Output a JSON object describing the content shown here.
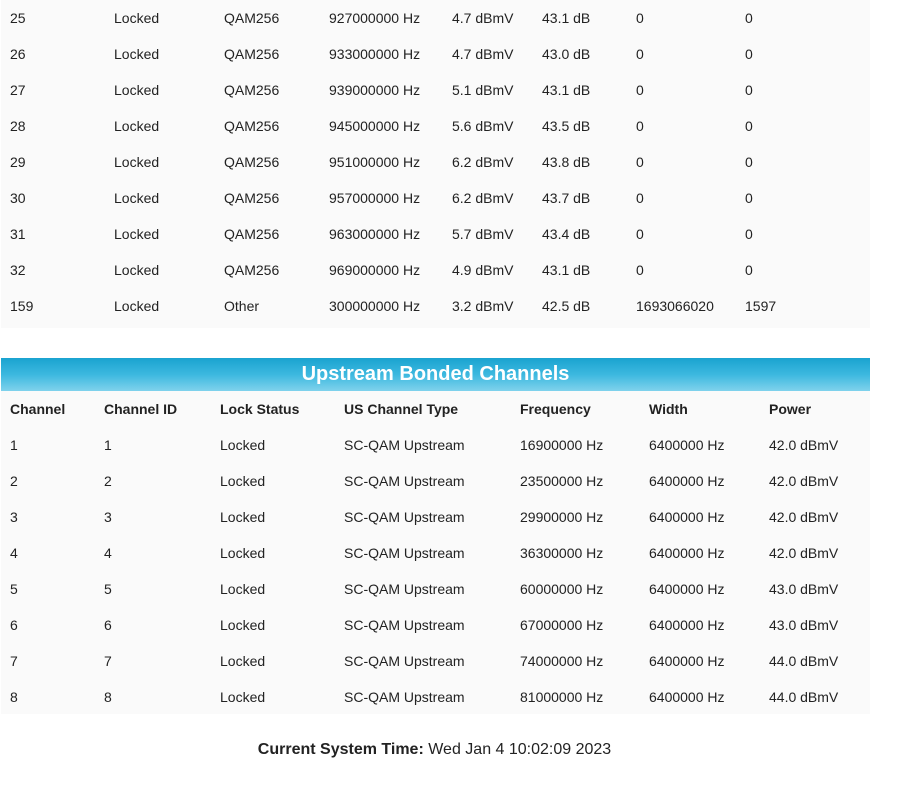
{
  "downstream": {
    "rows": [
      {
        "channel": "25",
        "lock_status": "Locked",
        "modulation": "QAM256",
        "frequency": "927000000 Hz",
        "power": "4.7 dBmV",
        "snr": "43.1 dB",
        "corrected": "0",
        "uncorrectables": "0"
      },
      {
        "channel": "26",
        "lock_status": "Locked",
        "modulation": "QAM256",
        "frequency": "933000000 Hz",
        "power": "4.7 dBmV",
        "snr": "43.0 dB",
        "corrected": "0",
        "uncorrectables": "0"
      },
      {
        "channel": "27",
        "lock_status": "Locked",
        "modulation": "QAM256",
        "frequency": "939000000 Hz",
        "power": "5.1 dBmV",
        "snr": "43.1 dB",
        "corrected": "0",
        "uncorrectables": "0"
      },
      {
        "channel": "28",
        "lock_status": "Locked",
        "modulation": "QAM256",
        "frequency": "945000000 Hz",
        "power": "5.6 dBmV",
        "snr": "43.5 dB",
        "corrected": "0",
        "uncorrectables": "0"
      },
      {
        "channel": "29",
        "lock_status": "Locked",
        "modulation": "QAM256",
        "frequency": "951000000 Hz",
        "power": "6.2 dBmV",
        "snr": "43.8 dB",
        "corrected": "0",
        "uncorrectables": "0"
      },
      {
        "channel": "30",
        "lock_status": "Locked",
        "modulation": "QAM256",
        "frequency": "957000000 Hz",
        "power": "6.2 dBmV",
        "snr": "43.7 dB",
        "corrected": "0",
        "uncorrectables": "0"
      },
      {
        "channel": "31",
        "lock_status": "Locked",
        "modulation": "QAM256",
        "frequency": "963000000 Hz",
        "power": "5.7 dBmV",
        "snr": "43.4 dB",
        "corrected": "0",
        "uncorrectables": "0"
      },
      {
        "channel": "32",
        "lock_status": "Locked",
        "modulation": "QAM256",
        "frequency": "969000000 Hz",
        "power": "4.9 dBmV",
        "snr": "43.1 dB",
        "corrected": "0",
        "uncorrectables": "0"
      },
      {
        "channel": "159",
        "lock_status": "Locked",
        "modulation": "Other",
        "frequency": "300000000 Hz",
        "power": "3.2 dBmV",
        "snr": "42.5 dB",
        "corrected": "1693066020",
        "uncorrectables": "1597"
      }
    ]
  },
  "upstream": {
    "title": "Upstream Bonded Channels",
    "headers": {
      "channel": "Channel",
      "channel_id": "Channel ID",
      "lock_status": "Lock Status",
      "channel_type": "US Channel Type",
      "frequency": "Frequency",
      "width": "Width",
      "power": "Power"
    },
    "rows": [
      {
        "channel": "1",
        "channel_id": "1",
        "lock_status": "Locked",
        "channel_type": "SC-QAM Upstream",
        "frequency": "16900000 Hz",
        "width": "6400000 Hz",
        "power": "42.0 dBmV"
      },
      {
        "channel": "2",
        "channel_id": "2",
        "lock_status": "Locked",
        "channel_type": "SC-QAM Upstream",
        "frequency": "23500000 Hz",
        "width": "6400000 Hz",
        "power": "42.0 dBmV"
      },
      {
        "channel": "3",
        "channel_id": "3",
        "lock_status": "Locked",
        "channel_type": "SC-QAM Upstream",
        "frequency": "29900000 Hz",
        "width": "6400000 Hz",
        "power": "42.0 dBmV"
      },
      {
        "channel": "4",
        "channel_id": "4",
        "lock_status": "Locked",
        "channel_type": "SC-QAM Upstream",
        "frequency": "36300000 Hz",
        "width": "6400000 Hz",
        "power": "42.0 dBmV"
      },
      {
        "channel": "5",
        "channel_id": "5",
        "lock_status": "Locked",
        "channel_type": "SC-QAM Upstream",
        "frequency": "60000000 Hz",
        "width": "6400000 Hz",
        "power": "43.0 dBmV"
      },
      {
        "channel": "6",
        "channel_id": "6",
        "lock_status": "Locked",
        "channel_type": "SC-QAM Upstream",
        "frequency": "67000000 Hz",
        "width": "6400000 Hz",
        "power": "43.0 dBmV"
      },
      {
        "channel": "7",
        "channel_id": "7",
        "lock_status": "Locked",
        "channel_type": "SC-QAM Upstream",
        "frequency": "74000000 Hz",
        "width": "6400000 Hz",
        "power": "44.0 dBmV"
      },
      {
        "channel": "8",
        "channel_id": "8",
        "lock_status": "Locked",
        "channel_type": "SC-QAM Upstream",
        "frequency": "81000000 Hz",
        "width": "6400000 Hz",
        "power": "44.0 dBmV"
      }
    ]
  },
  "system_time": {
    "label": "Current System Time:",
    "value": "Wed Jan 4 10:02:09 2023"
  }
}
